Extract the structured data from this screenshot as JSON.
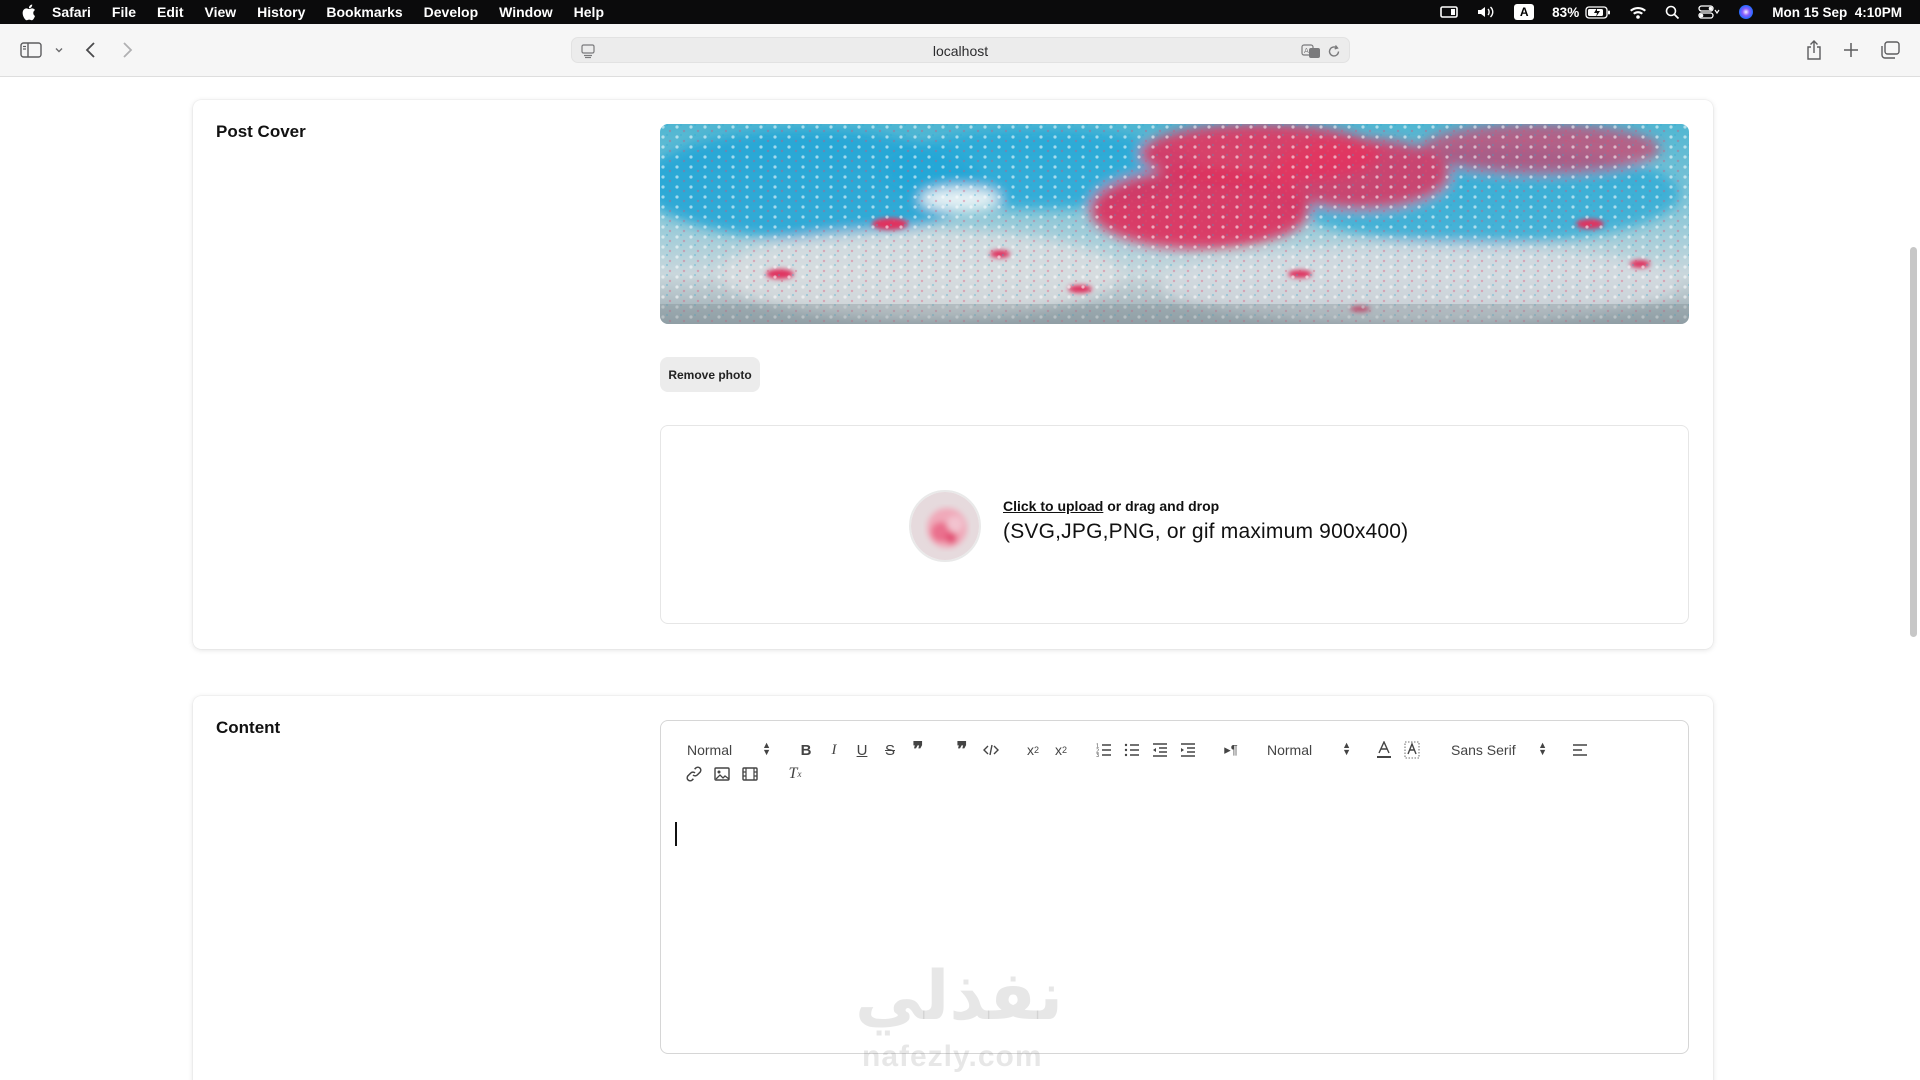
{
  "menubar": {
    "app_name": "Safari",
    "items": [
      "File",
      "Edit",
      "View",
      "History",
      "Bookmarks",
      "Develop",
      "Window",
      "Help"
    ],
    "input_source": "A",
    "battery": "83%",
    "datetime": "Mon 15 Sep  4:10PM",
    "icons": [
      "apple-icon",
      "screen-mirror-icon",
      "volume-icon",
      "battery-icon",
      "wifi-icon",
      "spotlight-icon",
      "control-center-icon",
      "siri-icon"
    ]
  },
  "browser": {
    "url": "localhost",
    "icons": [
      "sidebar-icon",
      "chevron-down-icon",
      "back-icon",
      "forward-icon",
      "page-menu-icon",
      "translate-icon",
      "reload-icon",
      "share-icon",
      "new-tab-icon",
      "tab-overview-icon"
    ]
  },
  "post_cover": {
    "title": "Post Cover",
    "remove_button": "Remove photo",
    "upload_link": "Click to upload",
    "upload_rest": " or drag and drop",
    "formats": "(SVG,JPG,PNG, or gif maximum 900x400)"
  },
  "content": {
    "title": "Content",
    "header_picker": "Normal",
    "size_picker": "Normal",
    "font_picker": "Sans Serif",
    "toolbar_row1": [
      "bold-icon",
      "italic-icon",
      "underline-icon",
      "strike-icon",
      "blockquote-icon",
      "quote-icon",
      "code-icon",
      "subscript-icon",
      "superscript-icon",
      "ordered-list-icon",
      "bullet-list-icon",
      "outdent-icon",
      "indent-icon",
      "rtl-direction-icon",
      "text-color-icon",
      "background-color-icon",
      "align-icon"
    ],
    "toolbar_row2": [
      "link-icon",
      "image-icon",
      "video-icon",
      "clear-format-icon"
    ]
  },
  "watermark": {
    "arabic": "نفذلي",
    "latin": "nafezly.com"
  },
  "colors": {
    "menubar_bg": "#0b0b0c",
    "toolbar_bg": "#f6f6f6",
    "card_bg": "#ffffff",
    "button_bg": "#ececec",
    "text": "#111111"
  }
}
